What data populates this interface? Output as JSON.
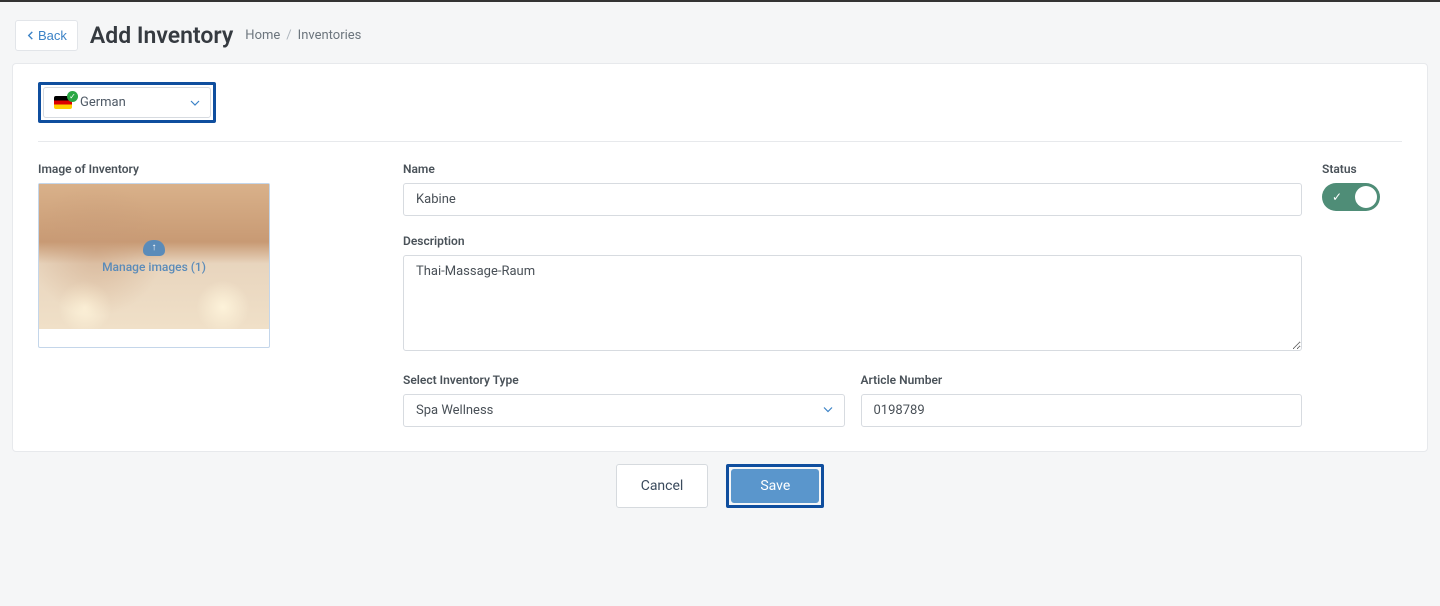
{
  "header": {
    "back_label": "Back",
    "title": "Add Inventory"
  },
  "breadcrumb": {
    "home": "Home",
    "current": "Inventories"
  },
  "language": {
    "selected": "German"
  },
  "form": {
    "image_label": "Image of Inventory",
    "manage_text": "Manage images (1)",
    "name_label": "Name",
    "name_value": "Kabine",
    "description_label": "Description",
    "description_value": "Thai-Massage-Raum",
    "type_label": "Select Inventory Type",
    "type_value": "Spa Wellness",
    "article_label": "Article Number",
    "article_value": "0198789",
    "status_label": "Status"
  },
  "actions": {
    "cancel": "Cancel",
    "save": "Save"
  }
}
